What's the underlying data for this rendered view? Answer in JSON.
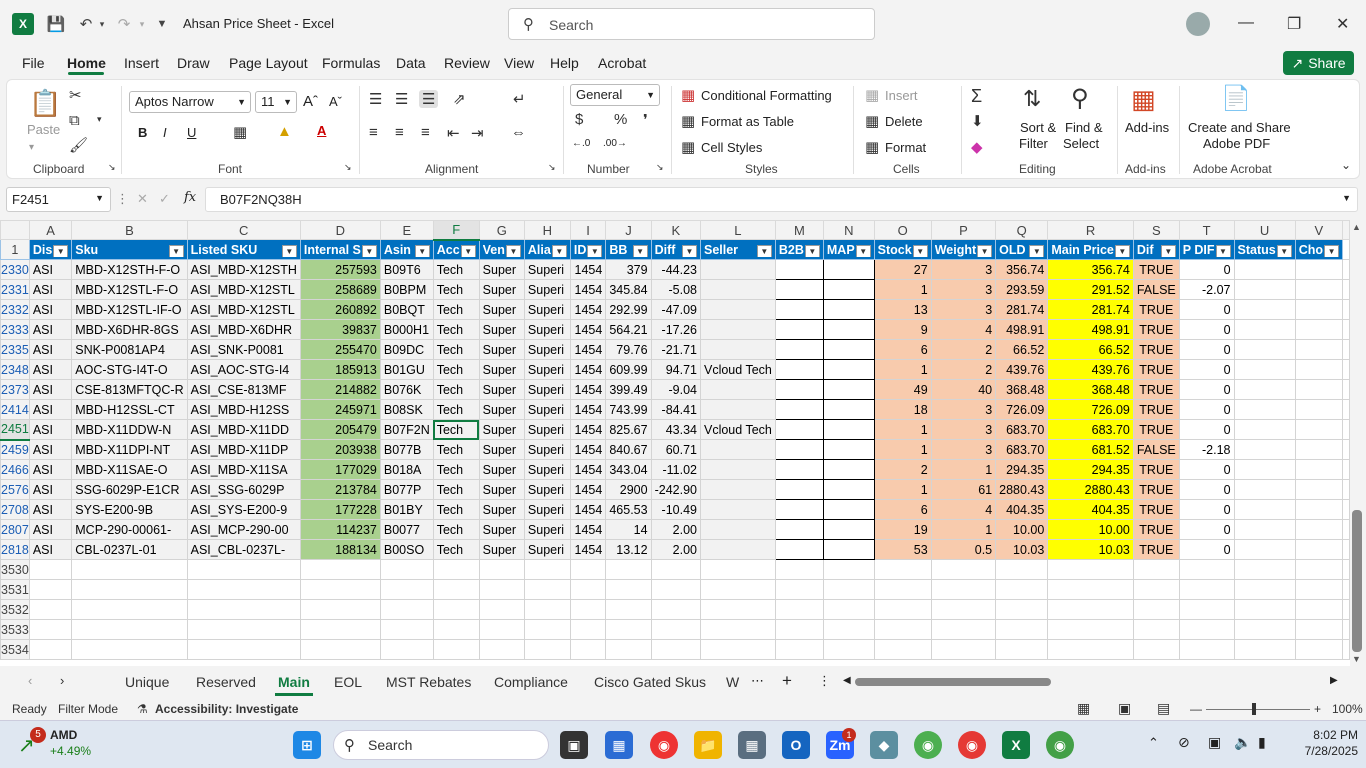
{
  "window": {
    "title": "Ahsan Price Sheet  -  Excel",
    "search_placeholder": "Search",
    "app_icon": "X"
  },
  "menu": {
    "items": [
      "File",
      "Home",
      "Insert",
      "Draw",
      "Page Layout",
      "Formulas",
      "Data",
      "Review",
      "View",
      "Help",
      "Acrobat"
    ],
    "active": "Home",
    "share_label": "Share"
  },
  "ribbon": {
    "clipboard": {
      "paste": "Paste",
      "label": "Clipboard"
    },
    "font": {
      "family": "Aptos Narrow",
      "size": "11",
      "label": "Font"
    },
    "alignment": {
      "label": "Alignment"
    },
    "number": {
      "format": "General",
      "label": "Number"
    },
    "styles": {
      "conditional": "Conditional Formatting",
      "format_table": "Format as Table",
      "cell_styles": "Cell Styles",
      "label": "Styles"
    },
    "cells": {
      "insert": "Insert",
      "delete": "Delete",
      "format": "Format",
      "label": "Cells"
    },
    "editing": {
      "sort": "Sort &",
      "filter": "Filter",
      "find": "Find &",
      "select": "Select",
      "label": "Editing"
    },
    "addins": {
      "btn": "Add-ins",
      "label": "Add-ins"
    },
    "acrobat": {
      "line1": "Create and Share",
      "line2": "Adobe PDF",
      "label": "Adobe Acrobat"
    }
  },
  "formula_bar": {
    "name_box": "F2451",
    "fx": "fx",
    "content": "B07F2NQ38H"
  },
  "columns": [
    "A",
    "B",
    "C",
    "D",
    "E",
    "F",
    "G",
    "H",
    "I",
    "J",
    "K",
    "L",
    "M",
    "N",
    "O",
    "P",
    "Q",
    "R",
    "S",
    "T",
    "U",
    "V"
  ],
  "headers": [
    "Dis",
    "Sku",
    "Listed SKU",
    "Internal S",
    "Asin",
    "Acc",
    "Ven",
    "Alia",
    "ID",
    "BB",
    "Diff",
    "Seller",
    "B2B",
    "MAP",
    "Stock",
    "Weight",
    "OLD",
    "Main Price",
    "Dif",
    "P DIF",
    "Status",
    "Cho"
  ],
  "header_row_num": "1",
  "rows": [
    {
      "num": "2330",
      "cells": [
        "ASI",
        "MBD-X12STH-F-O",
        "ASI_MBD-X12STH",
        "257593",
        "B09T6",
        "Tech",
        "Super",
        "Superi",
        "1454",
        "379",
        "-44.23",
        "",
        "",
        "",
        "27",
        "3",
        "356.74",
        "356.74",
        "TRUE",
        "0",
        "",
        ""
      ]
    },
    {
      "num": "2331",
      "cells": [
        "ASI",
        "MBD-X12STL-F-O",
        "ASI_MBD-X12STL",
        "258689",
        "B0BPM",
        "Tech",
        "Super",
        "Superi",
        "1454",
        "345.84",
        "-5.08",
        "",
        "",
        "",
        "1",
        "3",
        "293.59",
        "291.52",
        "FALSE",
        "-2.07",
        "",
        ""
      ]
    },
    {
      "num": "2332",
      "cells": [
        "ASI",
        "MBD-X12STL-IF-O",
        "ASI_MBD-X12STL",
        "260892",
        "B0BQT",
        "Tech",
        "Super",
        "Superi",
        "1454",
        "292.99",
        "-47.09",
        "",
        "",
        "",
        "13",
        "3",
        "281.74",
        "281.74",
        "TRUE",
        "0",
        "",
        ""
      ]
    },
    {
      "num": "2333",
      "cells": [
        "ASI",
        "MBD-X6DHR-8GS",
        "ASI_MBD-X6DHR",
        "39837",
        "B000H1",
        "Tech",
        "Super",
        "Superi",
        "1454",
        "564.21",
        "-17.26",
        "",
        "",
        "",
        "9",
        "4",
        "498.91",
        "498.91",
        "TRUE",
        "0",
        "",
        ""
      ]
    },
    {
      "num": "2335",
      "cells": [
        "ASI",
        "SNK-P0081AP4",
        "ASI_SNK-P0081",
        "255470",
        "B09DC",
        "Tech",
        "Super",
        "Superi",
        "1454",
        "79.76",
        "-21.71",
        "",
        "",
        "",
        "6",
        "2",
        "66.52",
        "66.52",
        "TRUE",
        "0",
        "",
        ""
      ]
    },
    {
      "num": "2348",
      "cells": [
        "ASI",
        "AOC-STG-I4T-O",
        "ASI_AOC-STG-I4",
        "185913",
        "B01GU",
        "Tech",
        "Super",
        "Superi",
        "1454",
        "609.99",
        "94.71",
        "Vcloud Tech",
        "",
        "",
        "1",
        "2",
        "439.76",
        "439.76",
        "TRUE",
        "0",
        "",
        ""
      ]
    },
    {
      "num": "2373",
      "cells": [
        "ASI",
        "CSE-813MFTQC-R",
        "ASI_CSE-813MF",
        "214882",
        "B076K",
        "Tech",
        "Super",
        "Superi",
        "1454",
        "399.49",
        "-9.04",
        "",
        "",
        "",
        "49",
        "40",
        "368.48",
        "368.48",
        "TRUE",
        "0",
        "",
        ""
      ]
    },
    {
      "num": "2414",
      "cells": [
        "ASI",
        "MBD-H12SSL-CT",
        "ASI_MBD-H12SS",
        "245971",
        "B08SK",
        "Tech",
        "Super",
        "Superi",
        "1454",
        "743.99",
        "-84.41",
        "",
        "",
        "",
        "18",
        "3",
        "726.09",
        "726.09",
        "TRUE",
        "0",
        "",
        ""
      ]
    },
    {
      "num": "2451",
      "cells": [
        "ASI",
        "MBD-X11DDW-N",
        "ASI_MBD-X11DD",
        "205479",
        "B07F2N",
        "Tech",
        "Super",
        "Superi",
        "1454",
        "825.67",
        "43.34",
        "Vcloud Tech",
        "",
        "",
        "1",
        "3",
        "683.70",
        "683.70",
        "TRUE",
        "0",
        "",
        ""
      ]
    },
    {
      "num": "2459",
      "cells": [
        "ASI",
        "MBD-X11DPI-NT",
        "ASI_MBD-X11DP",
        "203938",
        "B077B",
        "Tech",
        "Super",
        "Superi",
        "1454",
        "840.67",
        "60.71",
        "",
        "",
        "",
        "1",
        "3",
        "683.70",
        "681.52",
        "FALSE",
        "-2.18",
        "",
        ""
      ]
    },
    {
      "num": "2466",
      "cells": [
        "ASI",
        "MBD-X11SAE-O",
        "ASI_MBD-X11SA",
        "177029",
        "B018A",
        "Tech",
        "Super",
        "Superi",
        "1454",
        "343.04",
        "-11.02",
        "",
        "",
        "",
        "2",
        "1",
        "294.35",
        "294.35",
        "TRUE",
        "0",
        "",
        ""
      ]
    },
    {
      "num": "2576",
      "cells": [
        "ASI",
        "SSG-6029P-E1CR",
        "ASI_SSG-6029P",
        "213784",
        "B077P",
        "Tech",
        "Super",
        "Superi",
        "1454",
        "2900",
        "-242.90",
        "",
        "",
        "",
        "1",
        "61",
        "2880.43",
        "2880.43",
        "TRUE",
        "0",
        "",
        ""
      ]
    },
    {
      "num": "2708",
      "cells": [
        "ASI",
        "SYS-E200-9B",
        "ASI_SYS-E200-9",
        "177228",
        "B01BY",
        "Tech",
        "Super",
        "Superi",
        "1454",
        "465.53",
        "-10.49",
        "",
        "",
        "",
        "6",
        "4",
        "404.35",
        "404.35",
        "TRUE",
        "0",
        "",
        ""
      ]
    },
    {
      "num": "2807",
      "cells": [
        "ASI",
        "MCP-290-00061-",
        "ASI_MCP-290-00",
        "114237",
        "B0077",
        "Tech",
        "Super",
        "Superi",
        "1454",
        "14",
        "2.00",
        "",
        "",
        "",
        "19",
        "1",
        "10.00",
        "10.00",
        "TRUE",
        "0",
        "",
        ""
      ]
    },
    {
      "num": "2818",
      "cells": [
        "ASI",
        "CBL-0237L-01",
        "ASI_CBL-0237L-",
        "188134",
        "B00SO",
        "Tech",
        "Super",
        "Superi",
        "1454",
        "13.12",
        "2.00",
        "",
        "",
        "",
        "53",
        "0.5",
        "10.03",
        "10.03",
        "TRUE",
        "0",
        "",
        ""
      ]
    }
  ],
  "empty_rows": [
    "3530",
    "3531",
    "3532",
    "3533",
    "3534"
  ],
  "sheet_tabs": [
    "Unique",
    "Reserved",
    "Main",
    "EOL",
    "MST Rebates",
    "Compliance",
    "Cisco Gated Skus",
    "W"
  ],
  "active_tab": "Main",
  "status": {
    "ready": "Ready",
    "mode": "Filter Mode",
    "accessibility": "Accessibility: Investigate",
    "zoom": "100%"
  },
  "taskbar": {
    "stock_name": "AMD",
    "stock_change": "+4.49%",
    "stock_badge": "5",
    "search": "Search",
    "time": "8:02 PM",
    "date": "7/28/2025"
  }
}
